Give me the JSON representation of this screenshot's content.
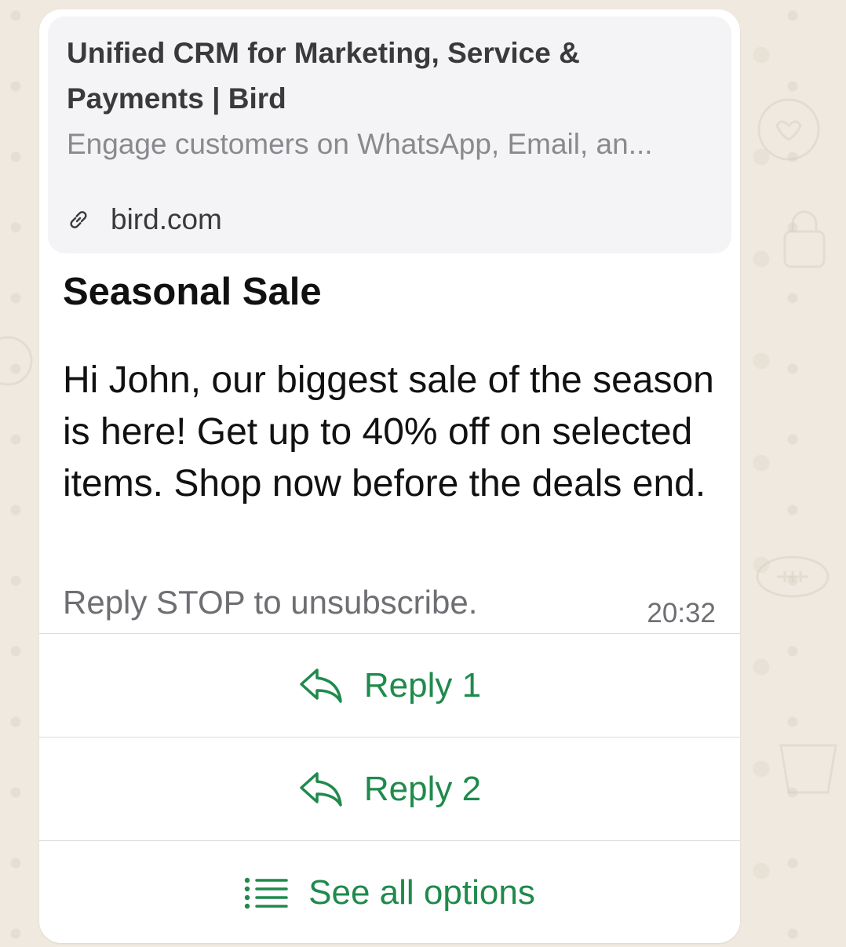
{
  "link_preview": {
    "title": "Unified CRM for Marketing, Service & Payments | Bird",
    "description": "Engage customers on WhatsApp, Email, an...",
    "domain": "bird.com"
  },
  "message": {
    "title": "Seasonal Sale",
    "body": "Hi John, our biggest sale of the season is here! Get up to 40% off on selected items. Shop now before the deals end.",
    "footer": "Reply STOP to unsubscribe.",
    "time": "20:32"
  },
  "actions": [
    {
      "label": "Reply 1",
      "icon": "reply-icon"
    },
    {
      "label": "Reply 2",
      "icon": "reply-icon"
    },
    {
      "label": "See all options",
      "icon": "list-icon"
    }
  ],
  "colors": {
    "accent": "#1f8a4c",
    "bubble": "#ffffff",
    "preview_bg": "#f4f3f5",
    "wallpaper": "#efe9df"
  }
}
